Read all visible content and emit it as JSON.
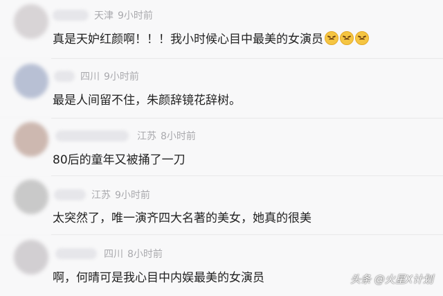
{
  "comments": [
    {
      "location": "天津",
      "time": "9小时前",
      "text": "真是天妒红颜啊！！！我小时候心目中最美的女演员",
      "emojis": [
        "angry-face-icon",
        "angry-face-icon",
        "angry-face-icon"
      ],
      "avatar_color": "#d8d4d6"
    },
    {
      "location": "四川",
      "time": "9小时前",
      "text": "最是人间留不住，朱颜辞镜花辞树。",
      "avatar_color": "#b8c0d4"
    },
    {
      "location": "江苏",
      "time": "8小时前",
      "text": "80后的童年又被捅了一刀",
      "avatar_color": "#cdb8b0"
    },
    {
      "location": "江苏",
      "time": "9小时前",
      "text": "太突然了，唯一演齐四大名著的美女，她真的很美",
      "avatar_color": "#c9c9c9"
    },
    {
      "location": "四川",
      "time": "8小时前",
      "text": "啊，何晴可是我心目中内娱最美的女演员",
      "avatar_color": "#d2cfd2"
    }
  ],
  "watermark": "头条 @火星X计划"
}
